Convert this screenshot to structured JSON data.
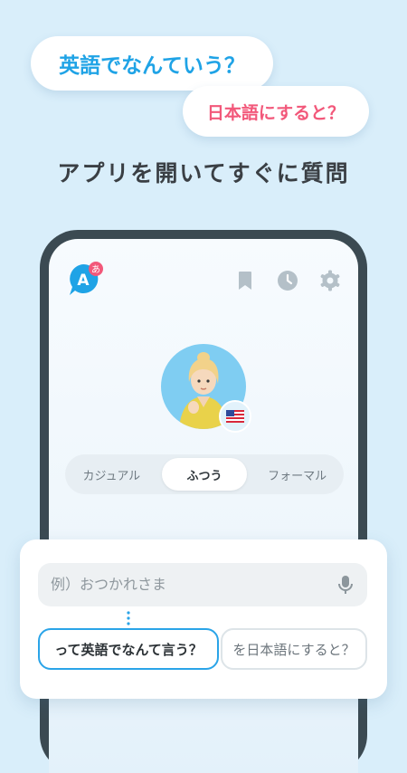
{
  "promo": {
    "bubble_primary": "英語でなんていう？",
    "bubble_secondary": "日本語にすると？",
    "headline": "アプリを開いてすぐに質問"
  },
  "app_header": {
    "logo_letter": "A",
    "logo_badge": "あ",
    "icons": [
      "bookmark-icon",
      "history-clock-icon",
      "settings-gear-icon"
    ]
  },
  "avatar": {
    "flag": "🇺🇸"
  },
  "tone_selector": {
    "options": [
      "カジュアル",
      "ふつう",
      "フォーマル"
    ],
    "selected": "ふつう"
  },
  "query_card": {
    "input_placeholder": "例）おつかれさま",
    "suggestions": [
      "って英語でなんて言う？",
      "を日本語にすると？"
    ]
  },
  "colors": {
    "background": "#d9eefa",
    "accent_blue": "#1fa3e6",
    "accent_pink": "#f2587a",
    "phone_frame": "#3b4a52"
  }
}
